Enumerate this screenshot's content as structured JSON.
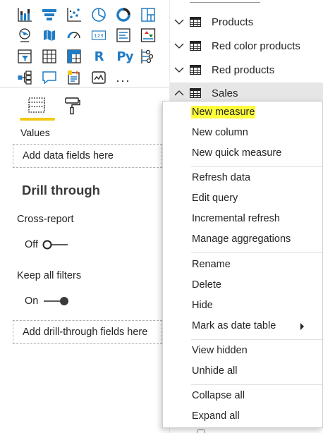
{
  "visualizations": {
    "icons": [
      "stacked-column-chart-icon",
      "funnel-chart-icon",
      "scatter-chart-icon",
      "pie-chart-icon",
      "donut-chart-icon",
      "treemap-icon",
      "map-icon",
      "filled-map-icon",
      "gauge-icon",
      "card-icon",
      "multi-row-card-icon",
      "kpi-icon",
      "slicer-icon",
      "table-icon",
      "matrix-icon",
      "r-script-visual-icon",
      "python-visual-icon",
      "key-influencers-icon",
      "decomposition-tree-icon",
      "qa-icon",
      "smart-narrative-icon",
      "paginated-report-icon",
      "more-visuals-icon"
    ],
    "r_label": "R",
    "py_label": "Py",
    "more_label": "...",
    "active_tab": "fields-well-tab",
    "accent_color": "#f2c811"
  },
  "wells": {
    "values_label": "Values",
    "values_placeholder": "Add data fields here",
    "drill_through_title": "Drill through",
    "cross_report_label": "Cross-report",
    "cross_report_state": "Off",
    "keep_filters_label": "Keep all filters",
    "keep_filters_state": "On",
    "drill_placeholder": "Add drill-through fields here"
  },
  "fields": {
    "tables": [
      {
        "name": "Products",
        "expanded": false
      },
      {
        "name": "Red color products",
        "expanded": false
      },
      {
        "name": "Red products",
        "expanded": false
      },
      {
        "name": "Sales",
        "expanded": true,
        "selected": true
      }
    ]
  },
  "context_menu": {
    "groups": [
      [
        "New measure",
        "New column",
        "New quick measure"
      ],
      [
        "Refresh data",
        "Edit query",
        "Incremental refresh",
        "Manage aggregations"
      ],
      [
        "Rename",
        "Delete",
        "Hide",
        "Mark as date table"
      ],
      [
        "View hidden",
        "Unhide all"
      ],
      [
        "Collapse all",
        "Expand all"
      ]
    ],
    "highlighted_item": "New measure",
    "highlight_color": "#ffff3c",
    "submenu_item": "Mark as date table"
  }
}
